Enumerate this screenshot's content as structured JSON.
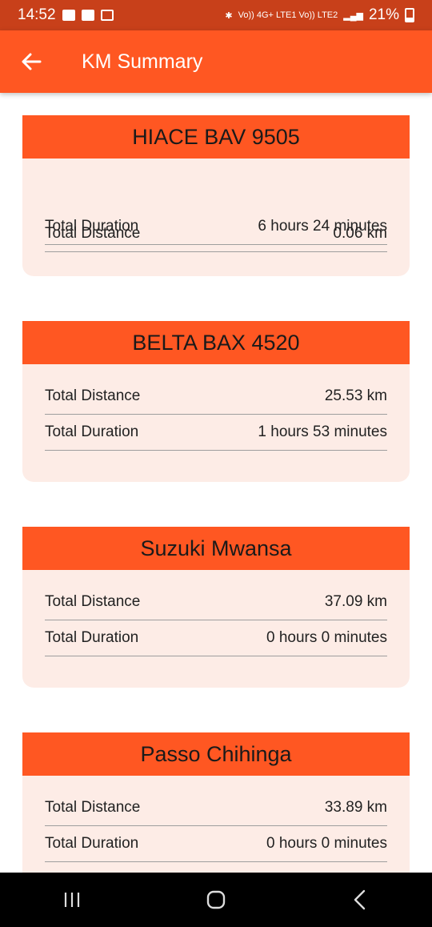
{
  "status_bar": {
    "time": "14:52",
    "network_text": "Vo)) 4G+ LTE1 Vo)) LTE2",
    "battery": "21%"
  },
  "app_bar": {
    "title": "KM Summary"
  },
  "vehicles": [
    {
      "name": "HIACE BAV 9505",
      "distance_label": "Total Distance",
      "distance": "0.06 km",
      "duration_label": "Total Duration",
      "duration": "6 hours 24 minutes"
    },
    {
      "name": "BELTA BAX 4520",
      "distance_label": "Total Distance",
      "distance": "25.53 km",
      "duration_label": "Total Duration",
      "duration": "1 hours 53 minutes"
    },
    {
      "name": "Suzuki Mwansa",
      "distance_label": "Total Distance",
      "distance": "37.09 km",
      "duration_label": "Total Duration",
      "duration": "0 hours 0 minutes"
    },
    {
      "name": "Passo Chihinga",
      "distance_label": "Total Distance",
      "distance": "33.89 km",
      "duration_label": "Total Duration",
      "duration": "0 hours 0 minutes"
    }
  ],
  "colors": {
    "status_bar": "#c8401a",
    "accent": "#ff5722",
    "card_bg": "#fdece6",
    "nav_bar": "#000000"
  },
  "icons": [
    "image-icon",
    "youtube-icon",
    "news-icon",
    "bluetooth-icon",
    "signal-icon",
    "battery-icon",
    "back-arrow-icon",
    "recents-icon",
    "home-icon",
    "back-icon"
  ]
}
